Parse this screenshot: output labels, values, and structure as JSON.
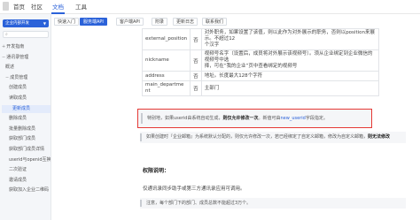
{
  "topnav": {
    "items": [
      "首页",
      "社区",
      "文档",
      "工具"
    ],
    "active_index": 2
  },
  "sidebar": {
    "select_label": "企业内部开发",
    "items": [
      {
        "label": "开发指南",
        "caret": "+",
        "level": 0
      },
      {
        "label": "通讯录管理",
        "caret": "−",
        "level": 0
      },
      {
        "label": "概述",
        "caret": "",
        "level": 1
      },
      {
        "label": "成员管理",
        "caret": "−",
        "level": 1
      },
      {
        "label": "创建成员",
        "caret": "",
        "level": 2
      },
      {
        "label": "读取成员",
        "caret": "",
        "level": 2
      },
      {
        "label": "更新成员",
        "caret": "",
        "level": 2,
        "active": true
      },
      {
        "label": "删除成员",
        "caret": "",
        "level": 2
      },
      {
        "label": "批量删除成员",
        "caret": "",
        "level": 2
      },
      {
        "label": "获取部门成员",
        "caret": "",
        "level": 2
      },
      {
        "label": "获取部门成员详情",
        "caret": "",
        "level": 2
      },
      {
        "label": "userid与openid互换",
        "caret": "",
        "level": 2
      },
      {
        "label": "二次验证",
        "caret": "",
        "level": 2
      },
      {
        "label": "邀请成员",
        "caret": "",
        "level": 2
      },
      {
        "label": "获取加入企业二维码",
        "caret": "",
        "level": 2
      }
    ]
  },
  "subtabs": [
    "快速入门",
    "服务端API",
    "客户端API",
    "附录",
    "更新日志",
    "联系我们"
  ],
  "subtabs_active_index": 1,
  "table": {
    "rows": [
      {
        "name": [
          "external_position"
        ],
        "required": "否",
        "desc": [
          "对外职务，如果设置了该值，则以此作为对外展示的职务，否则以position来展示。不超过12",
          "个汉字"
        ]
      },
      {
        "name": [
          "nickname"
        ],
        "required": "否",
        "desc": [
          "视频号名字（设置后，成员将对外展示该视频号）。须从企业绑定到企业微信的视频号中选",
          "择，可在“我的企业”页中查看绑定的视频号"
        ]
      },
      {
        "name": [
          "address"
        ],
        "required": "否",
        "desc": [
          "地址。长度最大128个字符"
        ]
      },
      {
        "name": [
          "main_departme",
          "nt"
        ],
        "required": "否",
        "desc": [
          "主部门"
        ]
      }
    ]
  },
  "notice": {
    "part1": "特别地，如果userid由系统自动生成，",
    "bold": "则仅允许修改一次",
    "part2": "。新值可由",
    "highlight": "new_userid",
    "part3": "字段指定。"
  },
  "note2": {
    "part1": "如果创建时『企业邮箱』为系统默认分配的，则仅允许修改一次，若已经绑定了自定义邮箱，修改为自定义邮箱，",
    "bold": "则无法修改"
  },
  "permission": {
    "title": "权限说明：",
    "text": "仅通讯录同步助手或第三方通讯录应用可调用。",
    "note": "注意，每个部门下的部门、成员总数不能超过3万个。"
  },
  "colors": {
    "accent": "#2b62d9",
    "highlight_border": "#e53935",
    "sidebar_bg": "#f4f6f9"
  }
}
